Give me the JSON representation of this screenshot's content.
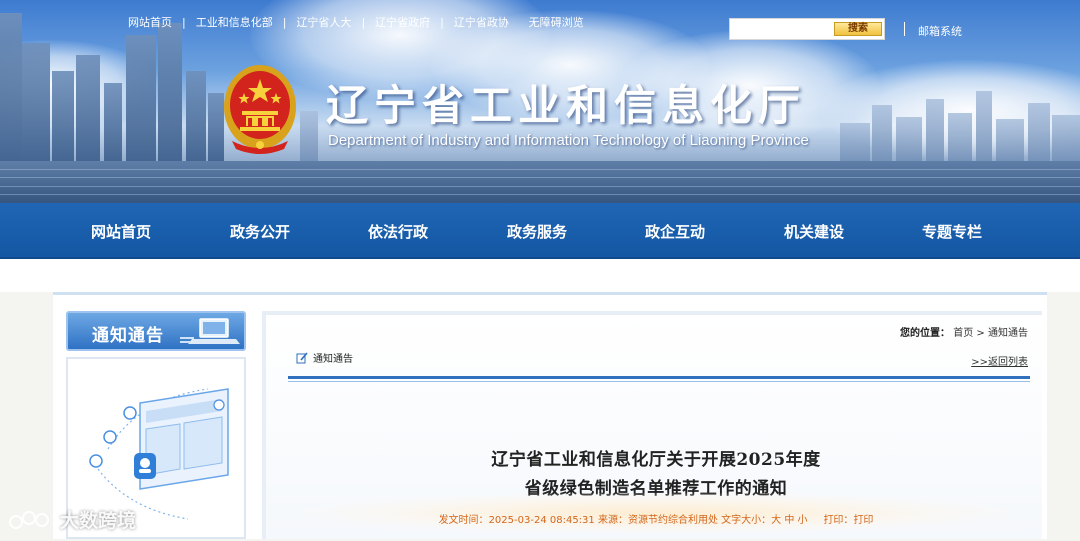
{
  "top_links": [
    "网站首页",
    "工业和信息化部",
    "辽宁省人大",
    "辽宁省政府",
    "辽宁省政协",
    "无障碍浏览"
  ],
  "search": {
    "button": "搜索",
    "placeholder": ""
  },
  "mail_link": "邮箱系统",
  "site": {
    "title": "辽宁省工业和信息化厅",
    "subtitle": "Department of Industry and Information Technology of Liaoning Province"
  },
  "nav": [
    "网站首页",
    "政务公开",
    "依法行政",
    "政务服务",
    "政企互动",
    "机关建设",
    "专题专栏"
  ],
  "sidebar": {
    "title": "通知通告"
  },
  "breadcrumb": {
    "label": "您的位置：",
    "home": "首页",
    "sep": ">",
    "current": "通知通告"
  },
  "category": "通知通告",
  "back_link": ">>返回列表",
  "article": {
    "title_line1": "辽宁省工业和信息化厅关于开展2025年度",
    "title_line2": "省级绿色制造名单推荐工作的通知",
    "meta_time_label": "发文时间：",
    "meta_time": "2025-03-24 08:45:31",
    "meta_source_label": "来源：",
    "meta_source": "资源节约综合利用处",
    "meta_font_label": "文字大小：",
    "font_sizes": [
      "大",
      "中",
      "小"
    ],
    "print_label": "打印：",
    "print_link": "打印"
  },
  "watermark": "大数跨境",
  "colors": {
    "nav_bg": "#1a5fad",
    "meta_text": "#d4661a",
    "accent_rule": "#2f6fbd"
  }
}
